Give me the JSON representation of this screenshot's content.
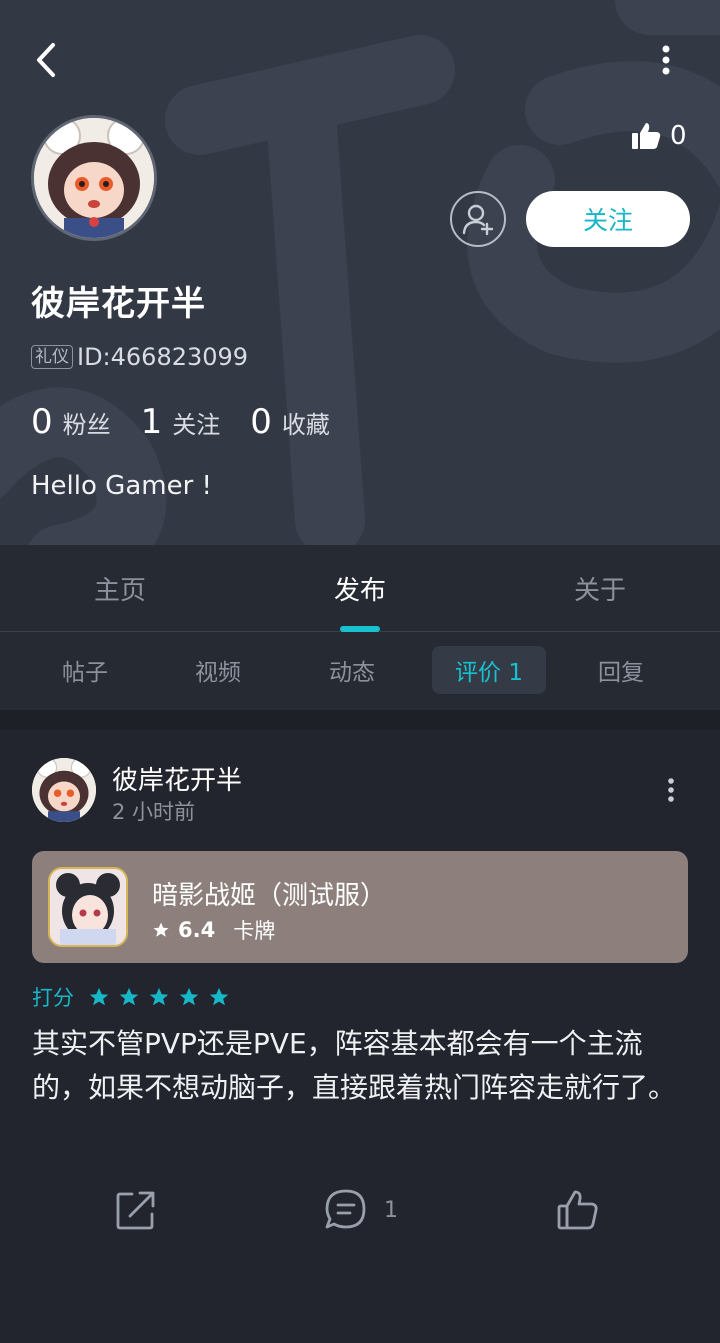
{
  "profile": {
    "likes": "0",
    "follow_label": "关注",
    "username": "彼岸花开半",
    "badge": "礼仪",
    "id_text": "ID:466823099",
    "stats": [
      {
        "num": "0",
        "label": "粉丝"
      },
      {
        "num": "1",
        "label": "关注"
      },
      {
        "num": "0",
        "label": "收藏"
      }
    ],
    "bio": "Hello Gamer !"
  },
  "tabs": [
    "主页",
    "发布",
    "关于"
  ],
  "active_tab": "发布",
  "subtabs": [
    "帖子",
    "视频",
    "动态",
    "评价 1",
    "回复"
  ],
  "active_subtab": "评价 1",
  "post": {
    "author": "彼岸花开半",
    "time": "2 小时前",
    "game": {
      "name": "暗影战姬（测试服）",
      "score": "6.4",
      "category": "卡牌"
    },
    "rating_label": "打分",
    "stars": 5,
    "content": "其实不管PVP还是PVE，阵容基本都会有一个主流的，如果不想动脑子，直接跟着热门阵容走就行了。",
    "comment_count": "1"
  },
  "colors": {
    "accent": "#17c1cf",
    "header_bg": "#333845",
    "page_bg": "#22252e",
    "game_card_bg": "#8d807c"
  }
}
